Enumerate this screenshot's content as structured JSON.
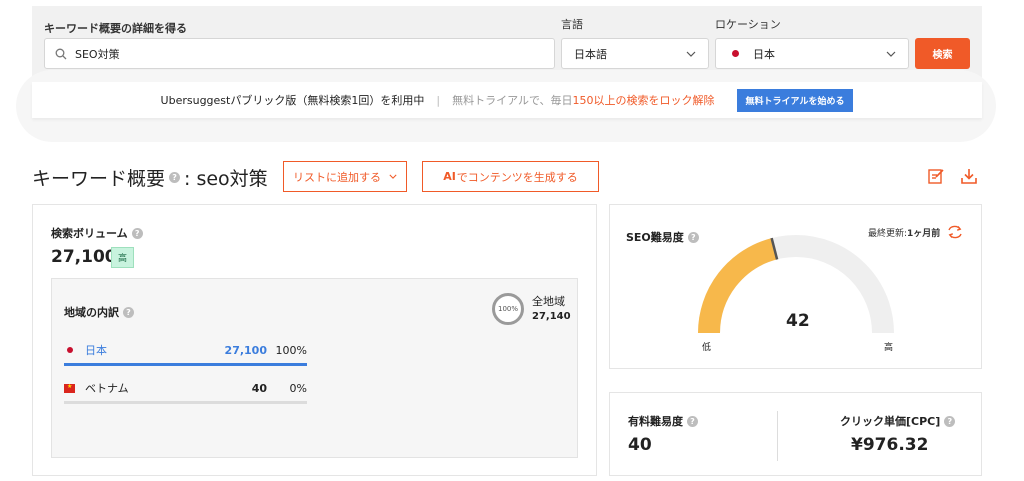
{
  "search": {
    "keyword_label": "キーワード概要の詳細を得る",
    "keyword_value": "SEO対策",
    "language_label": "言語",
    "language_value": "日本語",
    "location_label": "ロケーション",
    "location_value": "日本",
    "search_button": "検索"
  },
  "banner": {
    "text_main": "Ubersuggestパブリック版（無料検索1回）を利用中",
    "separator": "|",
    "text_muted": "無料トライアルで、毎日",
    "text_orange": "150以上の検索をロック解除",
    "trial_button": "無料トライアルを始める"
  },
  "header": {
    "title": "キーワード概要",
    "keyword": ": seo対策",
    "add_list_button": "リストに追加する",
    "ai_button_bold": "AI",
    "ai_button_rest": "でコンテンツを生成する"
  },
  "volume": {
    "label": "検索ボリューム",
    "value": "27,100",
    "badge": "高",
    "region_title": "地域の内訳",
    "total_ring": "100%",
    "total_label": "全地域",
    "total_value": "27,140",
    "regions": [
      {
        "name": "日本",
        "volume": "27,100",
        "percent": "100%",
        "fill": 1.0
      },
      {
        "name": "ベトナム",
        "volume": "40",
        "percent": "0%",
        "fill": 0.0
      }
    ]
  },
  "seo": {
    "label": "SEO難易度",
    "updated_prefix": "最終更新: ",
    "updated_value": "1ヶ月前",
    "score": "42",
    "score_fraction": 0.42,
    "low_label": "低",
    "high_label": "高"
  },
  "paid": {
    "label": "有料難易度",
    "value": "40",
    "cpc_label": "クリック単価[CPC]",
    "cpc_value": "¥976.32"
  },
  "colors": {
    "accent": "#f05a28",
    "blue": "#3b7ddd",
    "gauge": "#f7b84b"
  }
}
